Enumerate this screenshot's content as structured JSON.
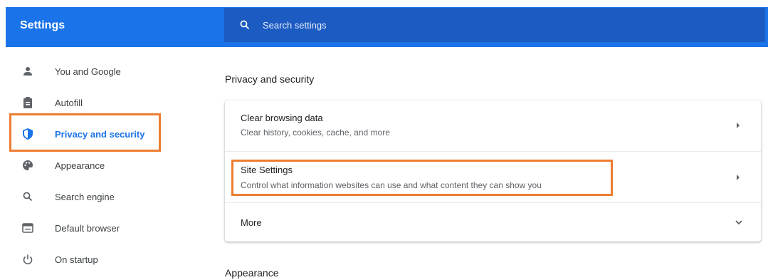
{
  "header": {
    "title": "Settings",
    "search_placeholder": "Search settings",
    "search_icon": "search-icon"
  },
  "sidebar": {
    "items": [
      {
        "label": "You and Google",
        "icon": "person-icon"
      },
      {
        "label": "Autofill",
        "icon": "clipboard-icon"
      },
      {
        "label": "Privacy and security",
        "icon": "shield-icon",
        "active": true
      },
      {
        "label": "Appearance",
        "icon": "palette-icon"
      },
      {
        "label": "Search engine",
        "icon": "search-icon"
      },
      {
        "label": "Default browser",
        "icon": "browser-icon"
      },
      {
        "label": "On startup",
        "icon": "power-icon"
      }
    ]
  },
  "main": {
    "section_title": "Privacy and security",
    "rows": [
      {
        "title": "Clear browsing data",
        "subtitle": "Clear history, cookies, cache, and more",
        "indicator": "arrow-right-icon"
      },
      {
        "title": "Site Settings",
        "subtitle": "Control what information websites can use and what content they can show you",
        "indicator": "arrow-right-icon"
      },
      {
        "title": "More",
        "indicator": "chevron-down-icon"
      }
    ],
    "next_section_title": "Appearance"
  },
  "colors": {
    "accent": "#1a73e8",
    "highlight": "#ed7d31"
  }
}
